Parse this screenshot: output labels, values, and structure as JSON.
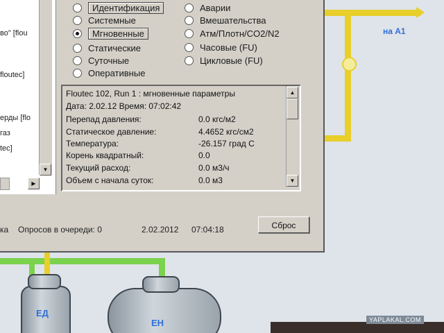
{
  "left_panel": {
    "lines": [
      "во\" [flou",
      "floutec]",
      "ерды [flo",
      "газ",
      "tec]"
    ]
  },
  "radio_left": [
    {
      "label": "Идентификация",
      "selected": false,
      "boxed": true
    },
    {
      "label": "Системные",
      "selected": false,
      "boxed": false
    },
    {
      "label": "Мгновенные",
      "selected": true,
      "boxed": true
    },
    {
      "label": "Статические",
      "selected": false,
      "boxed": false
    },
    {
      "label": "Суточные",
      "selected": false,
      "boxed": false
    },
    {
      "label": "Оперативные",
      "selected": false,
      "boxed": false
    }
  ],
  "radio_right": [
    {
      "label": "Аварии",
      "selected": false
    },
    {
      "label": "Вмешательства",
      "selected": false
    },
    {
      "label": "Атм/Плотн/CO2/N2",
      "selected": false
    },
    {
      "label": "Часовые (FU)",
      "selected": false
    },
    {
      "label": "Цикловые (FU)",
      "selected": false
    }
  ],
  "info": {
    "header": "Floutec 102, Run 1 : мгновенные параметры",
    "date_line": "Дата: 2.02.12  Время: 07:02:42",
    "params": [
      {
        "label": "Перепад давления:",
        "value": "0.0 кгс/м2"
      },
      {
        "label": "Статическое давление:",
        "value": "4.4652 кгс/см2"
      },
      {
        "label": "Температура:",
        "value": "-26.157 град С"
      },
      {
        "label": "Корень квадратный:",
        "value": "0.0"
      },
      {
        "label": "Текущий расход:",
        "value": "0.0 м3/ч"
      },
      {
        "label": "Объем с начала суток:",
        "value": "0.0 м3"
      }
    ]
  },
  "status": {
    "prefix": "ка",
    "queue": "Опросов в очереди: 0",
    "date": "2.02.2012",
    "time": "07:04:18"
  },
  "reset_label": "Сброс",
  "scada": {
    "arrow_label": "на А1",
    "tank_small": "ЕД",
    "tank_large": "ЕН"
  },
  "watermark": "YAPLAKAL.COM",
  "colors": {
    "pipe_yellow": "#e8cf2a",
    "pipe_green": "#7bd24d",
    "label_blue": "#2f6fd8"
  }
}
